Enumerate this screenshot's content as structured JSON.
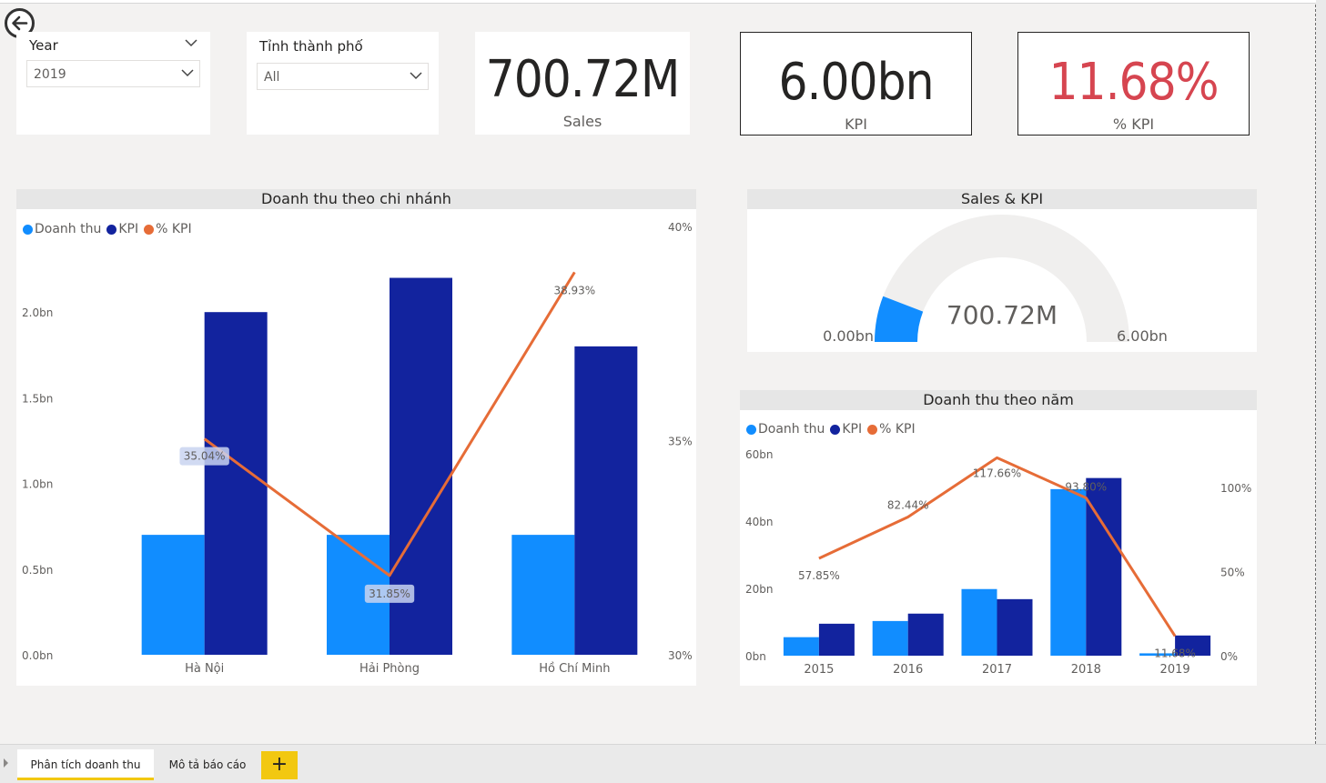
{
  "slicers": {
    "year": {
      "title": "Year",
      "value": "2019"
    },
    "province": {
      "title": "Tỉnh thành phố",
      "value": "All"
    }
  },
  "cards": {
    "sales": {
      "value": "700.72M",
      "label": "Sales"
    },
    "kpi": {
      "value": "6.00bn",
      "label": "KPI"
    },
    "pct_kpi": {
      "value": "11.68%",
      "label": "% KPI",
      "color": "#d64550"
    }
  },
  "legend": {
    "revenue": "Doanh thu",
    "kpi": "KPI",
    "pct": "% KPI"
  },
  "colors": {
    "revenue": "#118dff",
    "kpi": "#12239e",
    "pct": "#e66c37",
    "gauge_track": "#f0efee"
  },
  "gauge": {
    "title": "Sales & KPI",
    "value_label": "700.72M",
    "min_label": "0.00bn",
    "max_label": "6.00bn",
    "value": 0.70072,
    "max": 6.0
  },
  "chart_data": [
    {
      "type": "bar",
      "title": "Doanh thu theo chi nhánh",
      "categories": [
        "Hà Nội",
        "Hải Phòng",
        "Hồ Chí Minh"
      ],
      "series": [
        {
          "name": "Doanh thu",
          "values": [
            0.7,
            0.7,
            0.7
          ],
          "unit": "bn"
        },
        {
          "name": "KPI",
          "values": [
            2.0,
            2.2,
            1.8
          ],
          "unit": "bn"
        },
        {
          "name": "% KPI",
          "values": [
            35.04,
            31.85,
            38.93
          ],
          "unit": "%",
          "axis": "right",
          "chart_type": "line"
        }
      ],
      "data_labels": [
        "35.04%",
        "31.85%",
        "38.93%"
      ],
      "y_ticks": [
        "0.0bn",
        "0.5bn",
        "1.0bn",
        "1.5bn",
        "2.0bn"
      ],
      "y2_ticks": [
        "30%",
        "35%",
        "40%"
      ],
      "ylim": [
        0,
        2.5
      ],
      "y2lim": [
        30,
        40
      ]
    },
    {
      "type": "bar",
      "title": "Doanh thu theo năm",
      "categories": [
        "2015",
        "2016",
        "2017",
        "2018",
        "2019"
      ],
      "series": [
        {
          "name": "Doanh thu",
          "values": [
            5.5,
            10.3,
            19.8,
            49.5,
            0.7
          ],
          "unit": "bn"
        },
        {
          "name": "KPI",
          "values": [
            9.5,
            12.5,
            16.8,
            52.8,
            6.0
          ],
          "unit": "bn"
        },
        {
          "name": "% KPI",
          "values": [
            57.85,
            82.44,
            117.66,
            93.8,
            11.68
          ],
          "unit": "%",
          "axis": "right",
          "chart_type": "line"
        }
      ],
      "data_labels": [
        "57.85%",
        "82.44%",
        "117.66%",
        "93.80%",
        "11.68%"
      ],
      "y_ticks": [
        "0bn",
        "20bn",
        "40bn",
        "60bn"
      ],
      "y2_ticks": [
        "0%",
        "50%",
        "100%"
      ],
      "ylim": [
        0,
        60
      ],
      "y2lim": [
        0,
        120
      ]
    }
  ],
  "tabs": [
    {
      "label": "Phân tích doanh thu",
      "active": true
    },
    {
      "label": "Mô tả báo cáo",
      "active": false
    }
  ],
  "add_tab_label": "+"
}
